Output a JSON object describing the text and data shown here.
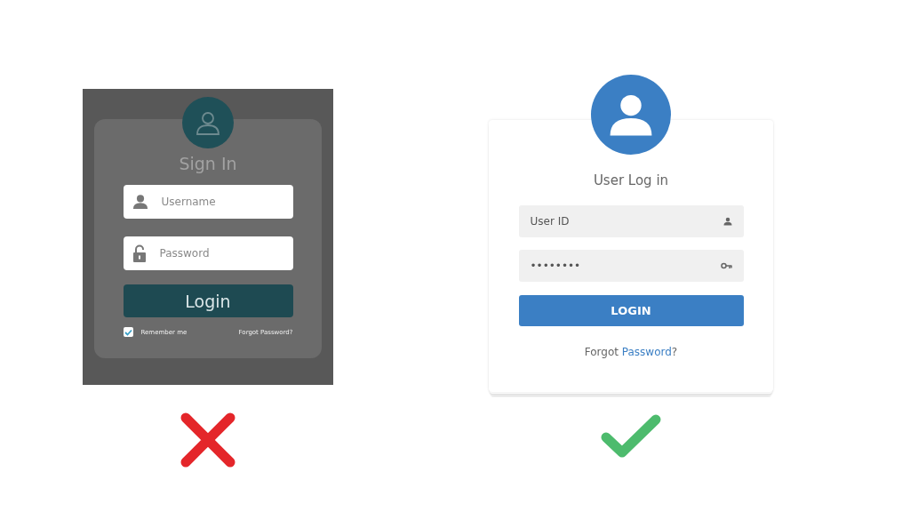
{
  "examples": [
    {
      "title": "Sign In",
      "fields": [
        {
          "kind": "user",
          "placeholder": "Username"
        },
        {
          "kind": "lock",
          "placeholder": "Password"
        }
      ],
      "button": "Login",
      "remember": {
        "label": "Remember me",
        "checked": true
      },
      "forgot": {
        "link": "Forgot Password?"
      }
    },
    {
      "title": "User Log in",
      "fields": [
        {
          "kind": "user",
          "placeholder": "User ID"
        },
        {
          "kind": "key",
          "value": "••••••••"
        }
      ],
      "button": "LOGIN",
      "forgot": {
        "prefix": "Forgot ",
        "link": "Password",
        "suffix": "?"
      }
    }
  ]
}
